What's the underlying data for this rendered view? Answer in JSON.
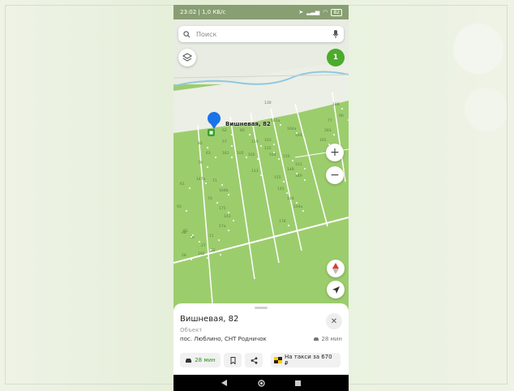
{
  "status": {
    "time_speed": "23:02 | 1,0 КБ/с",
    "battery": "82"
  },
  "search": {
    "placeholder": "Поиск"
  },
  "map": {
    "badge_count": "1",
    "pin_label": "Вишневая, 82",
    "zoom_in": "+",
    "zoom_out": "−",
    "plots": [
      "62",
      "80",
      "161a",
      "165",
      "164a",
      "164",
      "57",
      "119",
      "163",
      "82",
      "105",
      "181",
      "102",
      "104",
      "115",
      "150",
      "151",
      "79",
      "148",
      "149",
      "147a",
      "61",
      "113",
      "155",
      "71",
      "104b",
      "145",
      "70",
      "144",
      "93",
      "175",
      "104a",
      "143",
      "178",
      "55",
      "28",
      "11",
      "57a",
      "192",
      "27",
      "52",
      "48",
      "30",
      "283",
      "77",
      "90",
      "106",
      "130",
      "63"
    ]
  },
  "sheet": {
    "title": "Вишневая, 82",
    "subtitle": "Объект",
    "address": "пос. Люблино, СНТ Родничок",
    "time": "28 мин",
    "route_label": "28 мин",
    "taxi_label": "На такси за 670 ₽",
    "close_glyph": "✕"
  },
  "colors": {
    "map_green": "#9ccd6d",
    "accent_green": "#4bab2a",
    "pin_blue": "#1a73e8",
    "river": "#8fc8e0"
  }
}
